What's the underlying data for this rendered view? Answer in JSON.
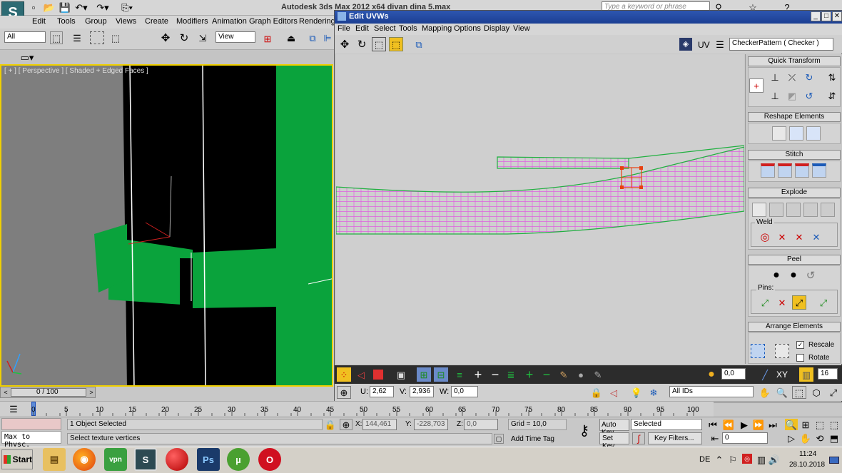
{
  "app": {
    "title": "Autodesk 3ds Max  2012 x64    divan dina 5.max",
    "search_placeholder": "Type a keyword or phrase",
    "menu": [
      "Edit",
      "Tools",
      "Group",
      "Views",
      "Create",
      "Modifiers",
      "Animation",
      "Graph Editors",
      "Rendering"
    ],
    "selection_filter": "All",
    "ref_coord": "View",
    "viewport_label": "[ + ] [ Perspective ] [ Shaded + Edged Faces ]"
  },
  "uvw": {
    "title": "Edit UVWs",
    "menu": [
      "File",
      "Edit",
      "Select",
      "Tools",
      "Mapping",
      "Options",
      "Display",
      "View"
    ],
    "uv_label": "UV",
    "map_dropdown": "CheckerPattern  ( Checker )",
    "panels": {
      "quick_transform": "Quick Transform",
      "reshape": "Reshape Elements",
      "stitch": "Stitch",
      "explode": "Explode",
      "weld": "Weld",
      "peel": "Peel",
      "pins": "Pins:",
      "arrange": "Arrange Elements",
      "rescale": "Rescale",
      "rotate": "Rotate"
    },
    "bottom": {
      "value1": "0,0",
      "xy": "XY",
      "spinner": "16",
      "u_label": "U:",
      "u_value": "2,62",
      "v_label": "V:",
      "v_value": "2,936",
      "w_label": "W:",
      "w_value": "0,0",
      "ids": "All IDs"
    }
  },
  "timeline": {
    "frame": "0 / 100",
    "ticks": [
      "0",
      "5",
      "10",
      "15",
      "20",
      "25",
      "30",
      "35",
      "40",
      "45",
      "50",
      "55",
      "60",
      "65",
      "70",
      "75",
      "80",
      "85",
      "90",
      "95",
      "100"
    ]
  },
  "status": {
    "maxscript": "Max to Physc.",
    "selected": "1 Object Selected",
    "prompt": "Select texture vertices",
    "x_label": "X:",
    "x": "144,461",
    "y_label": "Y:",
    "y": "-228,703",
    "z_label": "Z:",
    "z": "0,0",
    "grid": "Grid = 10,0",
    "add_time_tag": "Add Time Tag",
    "auto_key": "Auto Key",
    "set_key": "Set Key",
    "selected_dd": "Selected",
    "key_filters": "Key Filters...",
    "frame_field": "0"
  },
  "taskbar": {
    "start": "Start",
    "lang": "DE",
    "time": "11:24",
    "date": "28.10.2018",
    "apps": [
      "explorer",
      "firefox",
      "vpn",
      "3dsmax",
      "red-ball",
      "photoshop",
      "utorrent",
      "opera"
    ]
  },
  "colors": {
    "green": "#0aa33c",
    "uv_edge": "#e060e0",
    "uv_border": "#20b040",
    "selection": "#e84010",
    "titlebar": "#1c3f93"
  }
}
